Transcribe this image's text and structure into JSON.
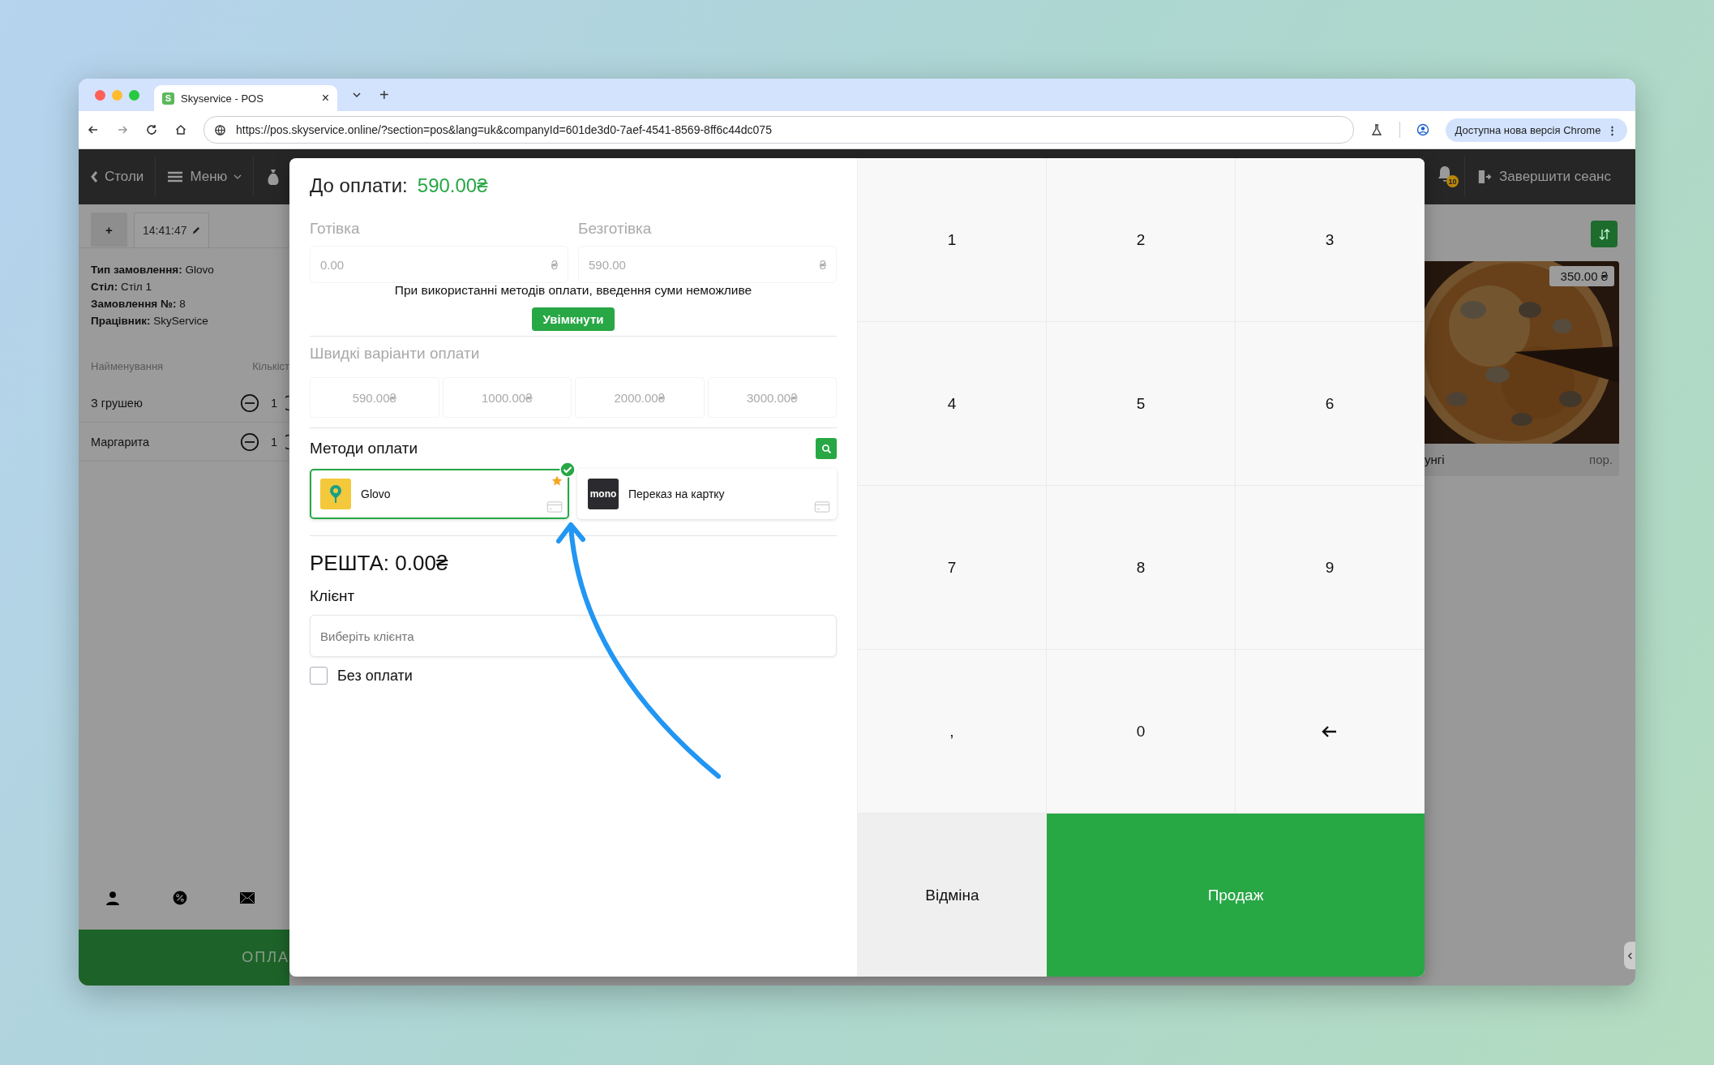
{
  "browser": {
    "tab_title": "Skyservice - POS",
    "favicon_letter": "S",
    "tab_close": "×",
    "new_tab": "+",
    "url": "https://pos.skyservice.online/?section=pos&lang=uk&companyId=601de3d0-7aef-4541-8569-8ff6c44dc075",
    "update_button": "Доступна нова версія Chrome",
    "menu_glyph": "⋮"
  },
  "header": {
    "back": "Столи",
    "menu": "Меню",
    "notifications_badge": "10",
    "logout": "Завершити сеанс"
  },
  "order": {
    "add_tab": "+",
    "tabs": [
      {
        "label": "14:41:47",
        "selected": true
      }
    ],
    "info": [
      "**Тип замовлення:** Glovo",
      "**Стіл:** Стіл 1",
      "**Замовлення №:** 8",
      "**Працівник:** SkyService"
    ],
    "columns": [
      "Найменування",
      "Кількіст"
    ],
    "items": [
      {
        "name": "З грушею",
        "qty": "1"
      },
      {
        "name": "Маргарита",
        "qty": "1"
      }
    ],
    "pay_button": "ОПЛА"
  },
  "product": {
    "price": "350.00 ₴",
    "name": "унгі",
    "unit": "пор."
  },
  "payment": {
    "title": "До оплати:",
    "amount": "590.00₴",
    "cash_label": "Готівка",
    "cash_value": "0.00",
    "cashless_label": "Безготівка",
    "cashless_value": "590.00",
    "currency": "₴",
    "inputs_disabled": true,
    "notice": "При використанні методів оплати, введення суми неможливе",
    "enable_button": "Увімкнути",
    "quick_label": "Швидкі варіанти оплати",
    "quick_options": [
      "590.00₴",
      "1000.00₴",
      "2000.00₴",
      "3000.00₴"
    ],
    "methods_label": "Методи оплати",
    "methods": [
      {
        "name": "Glovo",
        "kind": "glovo",
        "selected": true,
        "favorite": true
      },
      {
        "name": "Переказ на картку",
        "kind": "mono",
        "logo_text": "mono",
        "selected": false,
        "favorite": false
      }
    ],
    "change": "РЕШТА: 0.00₴",
    "client_label": "Клієнт",
    "client_placeholder": "Виберіть клієнта",
    "no_payment": {
      "label": "Без оплати",
      "checked": false
    }
  },
  "keypad": {
    "keys": [
      {
        "kind": "digit",
        "label": "1"
      },
      {
        "kind": "digit",
        "label": "2"
      },
      {
        "kind": "digit",
        "label": "3"
      },
      {
        "kind": "digit",
        "label": "4"
      },
      {
        "kind": "digit",
        "label": "5"
      },
      {
        "kind": "digit",
        "label": "6"
      },
      {
        "kind": "digit",
        "label": "7"
      },
      {
        "kind": "digit",
        "label": "8"
      },
      {
        "kind": "digit",
        "label": "9"
      },
      {
        "kind": "digit",
        "label": ","
      },
      {
        "kind": "digit",
        "label": "0"
      },
      {
        "kind": "backspace"
      }
    ],
    "cancel": "Відміна",
    "sell": "Продаж"
  }
}
